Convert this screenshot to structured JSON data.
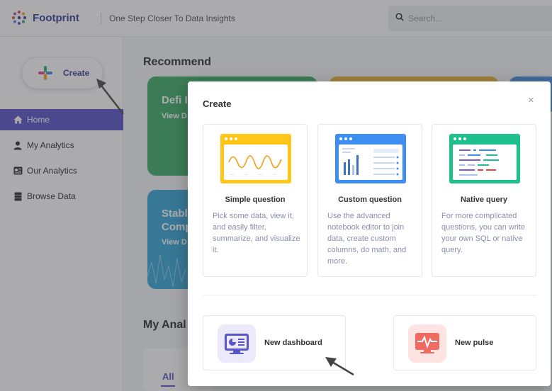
{
  "header": {
    "brand": "Footprint",
    "tagline": "One Step Closer To Data Insights",
    "search_placeholder": "Search..."
  },
  "sidebar": {
    "create_label": "Create",
    "items": [
      {
        "label": "Home",
        "icon": "home-icon",
        "active": true
      },
      {
        "label": "My Analytics",
        "icon": "user-icon",
        "active": false
      },
      {
        "label": "Our Analytics",
        "icon": "dashboard-icon",
        "active": false
      },
      {
        "label": "Browse Data",
        "icon": "database-icon",
        "active": false
      }
    ]
  },
  "main": {
    "recommend_title": "Recommend",
    "cards": [
      {
        "title": "Defi I",
        "link": "View D",
        "color": "#3fae6a"
      },
      {
        "title": "Stabl\nComp",
        "link": "View D",
        "color": "#38a8d8"
      }
    ],
    "my_analytics_title": "My Anal",
    "tab_all": "All"
  },
  "modal": {
    "title": "Create",
    "close": "×",
    "options": [
      {
        "title": "Simple question",
        "description": "Pick some data, view it, and easily filter, summarize, and visualize it.",
        "illustration": "line-chart-illustration",
        "color": "#ffc61a"
      },
      {
        "title": "Custom question",
        "description": "Use the advanced notebook editor to join data, create custom columns, do math, and more.",
        "illustration": "bar-chart-illustration",
        "color": "#3d8ef0"
      },
      {
        "title": "Native query",
        "description": "For more complicated questions, you can write your own SQL or native query.",
        "illustration": "code-illustration",
        "color": "#1fc08c"
      }
    ],
    "new_dashboard_label": "New dashboard",
    "new_pulse_label": "New pulse"
  },
  "colors": {
    "accent": "#5a55c9",
    "brand": "#3a3f96"
  }
}
